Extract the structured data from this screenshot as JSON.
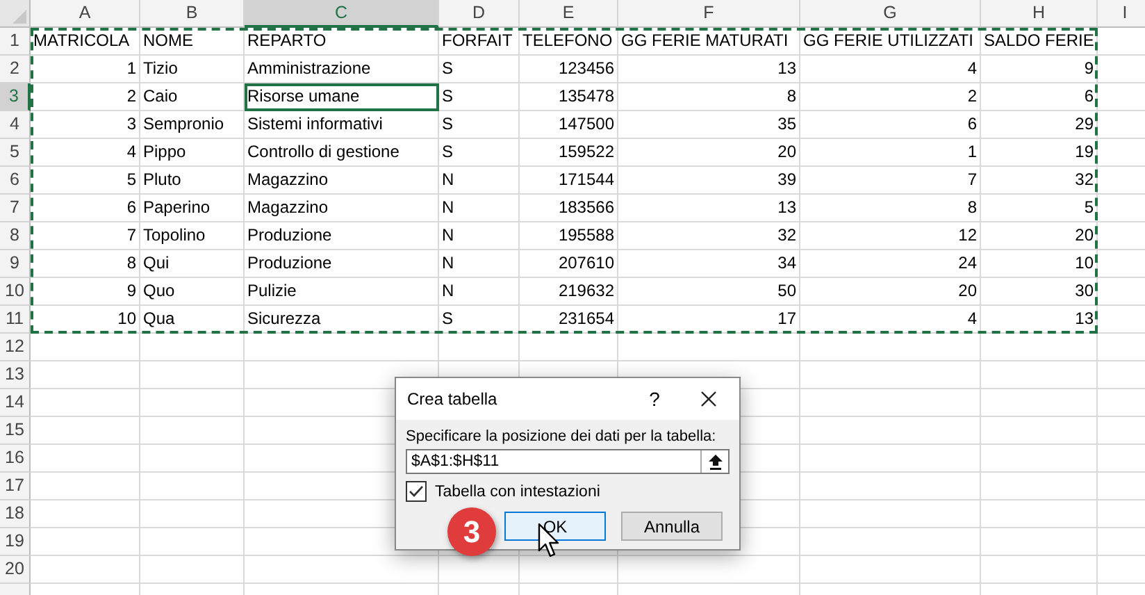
{
  "sheet": {
    "columns": [
      {
        "label": "A",
        "selected": false,
        "kind": "number"
      },
      {
        "label": "B",
        "selected": false,
        "kind": "text"
      },
      {
        "label": "C",
        "selected": true,
        "kind": "text"
      },
      {
        "label": "D",
        "selected": false,
        "kind": "text"
      },
      {
        "label": "E",
        "selected": false,
        "kind": "number"
      },
      {
        "label": "F",
        "selected": false,
        "kind": "number"
      },
      {
        "label": "G",
        "selected": false,
        "kind": "number"
      },
      {
        "label": "H",
        "selected": false,
        "kind": "number"
      },
      {
        "label": "I",
        "selected": false,
        "kind": "text"
      }
    ],
    "rows": [
      {
        "label": "1",
        "selected": false,
        "kind": "header",
        "cells": [
          {
            "text": "MATRICOLA",
            "selected": false
          },
          {
            "text": "NOME",
            "selected": false
          },
          {
            "text": "REPARTO",
            "selected": false
          },
          {
            "text": "FORFAIT",
            "selected": false
          },
          {
            "text": "TELEFONO",
            "selected": false
          },
          {
            "text": "GG FERIE MATURATI",
            "selected": false
          },
          {
            "text": "GG FERIE UTILIZZATI",
            "selected": false
          },
          {
            "text": "SALDO FERIE",
            "selected": false
          }
        ]
      },
      {
        "label": "2",
        "selected": false,
        "kind": "data",
        "cells": [
          {
            "text": "1",
            "selected": false
          },
          {
            "text": "Tizio",
            "selected": false
          },
          {
            "text": "Amministrazione",
            "selected": false
          },
          {
            "text": "S",
            "selected": false
          },
          {
            "text": "123456",
            "selected": false
          },
          {
            "text": "13",
            "selected": false
          },
          {
            "text": "4",
            "selected": false
          },
          {
            "text": "9",
            "selected": false
          }
        ]
      },
      {
        "label": "3",
        "selected": true,
        "kind": "data",
        "cells": [
          {
            "text": "2",
            "selected": false
          },
          {
            "text": "Caio",
            "selected": false
          },
          {
            "text": "Risorse umane",
            "selected": true
          },
          {
            "text": "S",
            "selected": false
          },
          {
            "text": "135478",
            "selected": false
          },
          {
            "text": "8",
            "selected": false
          },
          {
            "text": "2",
            "selected": false
          },
          {
            "text": "6",
            "selected": false
          }
        ]
      },
      {
        "label": "4",
        "selected": false,
        "kind": "data",
        "cells": [
          {
            "text": "3",
            "selected": false
          },
          {
            "text": "Sempronio",
            "selected": false
          },
          {
            "text": "Sistemi informativi",
            "selected": false
          },
          {
            "text": "S",
            "selected": false
          },
          {
            "text": "147500",
            "selected": false
          },
          {
            "text": "35",
            "selected": false
          },
          {
            "text": "6",
            "selected": false
          },
          {
            "text": "29",
            "selected": false
          }
        ]
      },
      {
        "label": "5",
        "selected": false,
        "kind": "data",
        "cells": [
          {
            "text": "4",
            "selected": false
          },
          {
            "text": "Pippo",
            "selected": false
          },
          {
            "text": "Controllo di gestione",
            "selected": false
          },
          {
            "text": "S",
            "selected": false
          },
          {
            "text": "159522",
            "selected": false
          },
          {
            "text": "20",
            "selected": false
          },
          {
            "text": "1",
            "selected": false
          },
          {
            "text": "19",
            "selected": false
          }
        ]
      },
      {
        "label": "6",
        "selected": false,
        "kind": "data",
        "cells": [
          {
            "text": "5",
            "selected": false
          },
          {
            "text": "Pluto",
            "selected": false
          },
          {
            "text": "Magazzino",
            "selected": false
          },
          {
            "text": "N",
            "selected": false
          },
          {
            "text": "171544",
            "selected": false
          },
          {
            "text": "39",
            "selected": false
          },
          {
            "text": "7",
            "selected": false
          },
          {
            "text": "32",
            "selected": false
          }
        ]
      },
      {
        "label": "7",
        "selected": false,
        "kind": "data",
        "cells": [
          {
            "text": "6",
            "selected": false
          },
          {
            "text": "Paperino",
            "selected": false
          },
          {
            "text": "Magazzino",
            "selected": false
          },
          {
            "text": "N",
            "selected": false
          },
          {
            "text": "183566",
            "selected": false
          },
          {
            "text": "13",
            "selected": false
          },
          {
            "text": "8",
            "selected": false
          },
          {
            "text": "5",
            "selected": false
          }
        ]
      },
      {
        "label": "8",
        "selected": false,
        "kind": "data",
        "cells": [
          {
            "text": "7",
            "selected": false
          },
          {
            "text": "Topolino",
            "selected": false
          },
          {
            "text": "Produzione",
            "selected": false
          },
          {
            "text": "N",
            "selected": false
          },
          {
            "text": "195588",
            "selected": false
          },
          {
            "text": "32",
            "selected": false
          },
          {
            "text": "12",
            "selected": false
          },
          {
            "text": "20",
            "selected": false
          }
        ]
      },
      {
        "label": "9",
        "selected": false,
        "kind": "data",
        "cells": [
          {
            "text": "8",
            "selected": false
          },
          {
            "text": "Qui",
            "selected": false
          },
          {
            "text": "Produzione",
            "selected": false
          },
          {
            "text": "N",
            "selected": false
          },
          {
            "text": "207610",
            "selected": false
          },
          {
            "text": "34",
            "selected": false
          },
          {
            "text": "24",
            "selected": false
          },
          {
            "text": "10",
            "selected": false
          }
        ]
      },
      {
        "label": "10",
        "selected": false,
        "kind": "data",
        "cells": [
          {
            "text": "9",
            "selected": false
          },
          {
            "text": "Quo",
            "selected": false
          },
          {
            "text": "Pulizie",
            "selected": false
          },
          {
            "text": "N",
            "selected": false
          },
          {
            "text": "219632",
            "selected": false
          },
          {
            "text": "50",
            "selected": false
          },
          {
            "text": "20",
            "selected": false
          },
          {
            "text": "30",
            "selected": false
          }
        ]
      },
      {
        "label": "11",
        "selected": false,
        "kind": "data",
        "cells": [
          {
            "text": "10",
            "selected": false
          },
          {
            "text": "Qua",
            "selected": false
          },
          {
            "text": "Sicurezza",
            "selected": false
          },
          {
            "text": "S",
            "selected": false
          },
          {
            "text": "231654",
            "selected": false
          },
          {
            "text": "17",
            "selected": false
          },
          {
            "text": "4",
            "selected": false
          },
          {
            "text": "13",
            "selected": false
          }
        ]
      },
      {
        "label": "12",
        "selected": false,
        "kind": "empty",
        "cells": []
      },
      {
        "label": "13",
        "selected": false,
        "kind": "empty",
        "cells": []
      },
      {
        "label": "14",
        "selected": false,
        "kind": "empty",
        "cells": []
      },
      {
        "label": "15",
        "selected": false,
        "kind": "empty",
        "cells": []
      },
      {
        "label": "16",
        "selected": false,
        "kind": "empty",
        "cells": []
      },
      {
        "label": "17",
        "selected": false,
        "kind": "empty",
        "cells": []
      },
      {
        "label": "18",
        "selected": false,
        "kind": "empty",
        "cells": []
      },
      {
        "label": "19",
        "selected": false,
        "kind": "empty",
        "cells": []
      },
      {
        "label": "20",
        "selected": false,
        "kind": "empty",
        "cells": []
      }
    ]
  },
  "dialog": {
    "title": "Crea tabella",
    "help": "?",
    "prompt": "Specificare la posizione dei dati per la tabella:",
    "range_value": "$A$1:$H$11",
    "checkbox": {
      "label": "Tabella con intestazioni",
      "checked": true
    },
    "buttons": [
      {
        "label": "OK",
        "selected": true
      },
      {
        "label": "Annulla",
        "selected": false
      }
    ]
  },
  "step_badge": "3"
}
